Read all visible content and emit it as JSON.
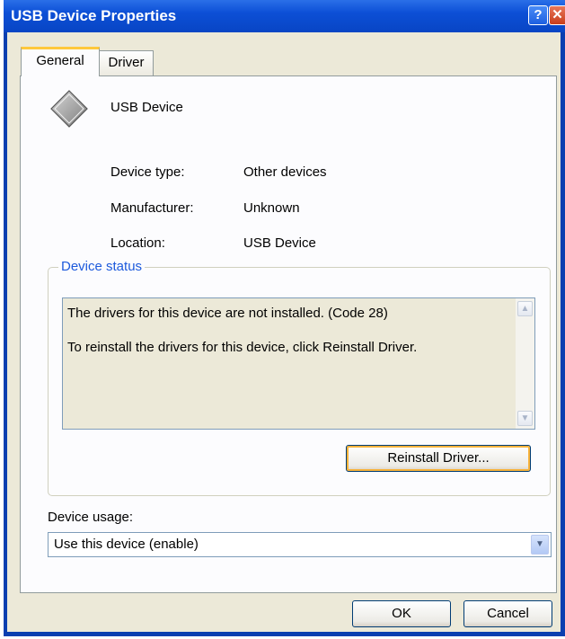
{
  "window": {
    "title": "USB Device Properties",
    "help_glyph": "?",
    "close_glyph": "✕"
  },
  "tabs": [
    {
      "label": "General",
      "selected": true
    },
    {
      "label": "Driver",
      "selected": false
    }
  ],
  "device": {
    "icon": "device-diamond-icon",
    "name": "USB Device"
  },
  "properties": [
    {
      "label": "Device type:",
      "value": "Other devices"
    },
    {
      "label": "Manufacturer:",
      "value": "Unknown"
    },
    {
      "label": "Location:",
      "value": "USB Device"
    }
  ],
  "status": {
    "group_label": "Device status",
    "lines": [
      "The drivers for this device are not installed. (Code 28)",
      "To reinstall the drivers for this device, click Reinstall Driver."
    ],
    "scroll_up_glyph": "▲",
    "scroll_down_glyph": "▼",
    "reinstall_label": "Reinstall Driver..."
  },
  "usage": {
    "label": "Device usage:",
    "selected": "Use this device (enable)",
    "arrow_glyph": "▼"
  },
  "buttons": {
    "ok_label": "OK",
    "cancel_label": "Cancel"
  },
  "colors": {
    "title_bar": "#0c4fd6",
    "dialog_bg": "#ece9d8",
    "panel_bg": "#fcfcfe",
    "group_label": "#1d5adc",
    "selected_tab_accent": "#ffc83c"
  }
}
